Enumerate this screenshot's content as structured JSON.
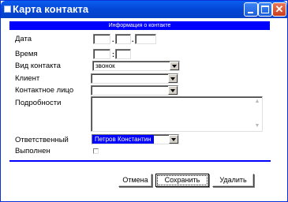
{
  "window": {
    "title": "Карта контакта",
    "icon": "window-icon"
  },
  "header": {
    "text": "Информация о контакте"
  },
  "form": {
    "date": {
      "label": "Дата",
      "day": "",
      "month": "",
      "year": "",
      "separator1": ".",
      "separator2": "."
    },
    "time": {
      "label": "Время",
      "hours": "",
      "minutes": "",
      "separator": ":"
    },
    "contact_type": {
      "label": "Вид контакта",
      "value": "звонок"
    },
    "client": {
      "label": "Клиент",
      "value": ""
    },
    "contact_person": {
      "label": "Контактное лицо",
      "value": ""
    },
    "details": {
      "label": "Подробности",
      "value": ""
    },
    "responsible": {
      "label": "Ответственный",
      "value": "Петров Константин"
    },
    "completed": {
      "label": "Выполнен",
      "checked": false
    }
  },
  "buttons": {
    "cancel": "Отмена",
    "save": "Сохранить",
    "delete": "Удалить"
  },
  "colors": {
    "title_bar": "#0446d6",
    "header_strip": "#0000ff",
    "divider": "#0000ff",
    "selection": "#0000ff"
  }
}
